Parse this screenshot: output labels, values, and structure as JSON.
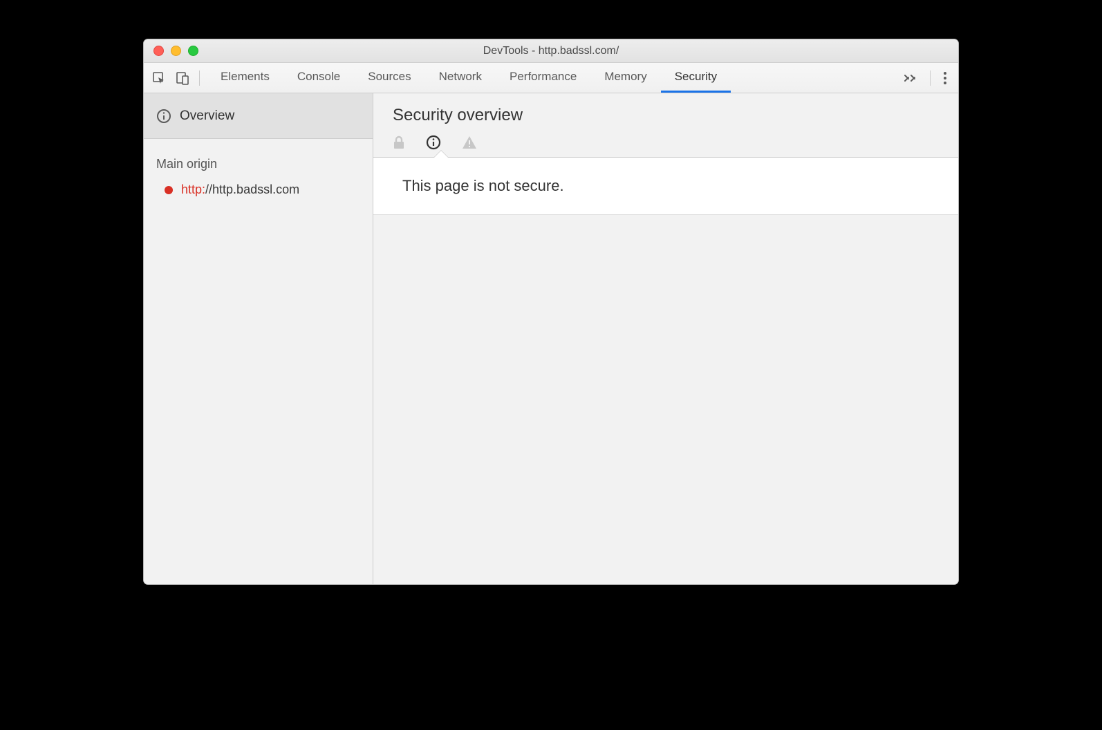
{
  "window": {
    "title": "DevTools - http.badssl.com/"
  },
  "tabs": [
    {
      "label": "Elements"
    },
    {
      "label": "Console"
    },
    {
      "label": "Sources"
    },
    {
      "label": "Network"
    },
    {
      "label": "Performance"
    },
    {
      "label": "Memory"
    },
    {
      "label": "Security",
      "active": true
    }
  ],
  "sidebar": {
    "overview_label": "Overview",
    "section_label": "Main origin",
    "origin": {
      "scheme": "http:",
      "rest": "//http.badssl.com"
    }
  },
  "main": {
    "title": "Security overview",
    "message": "This page is not secure."
  }
}
